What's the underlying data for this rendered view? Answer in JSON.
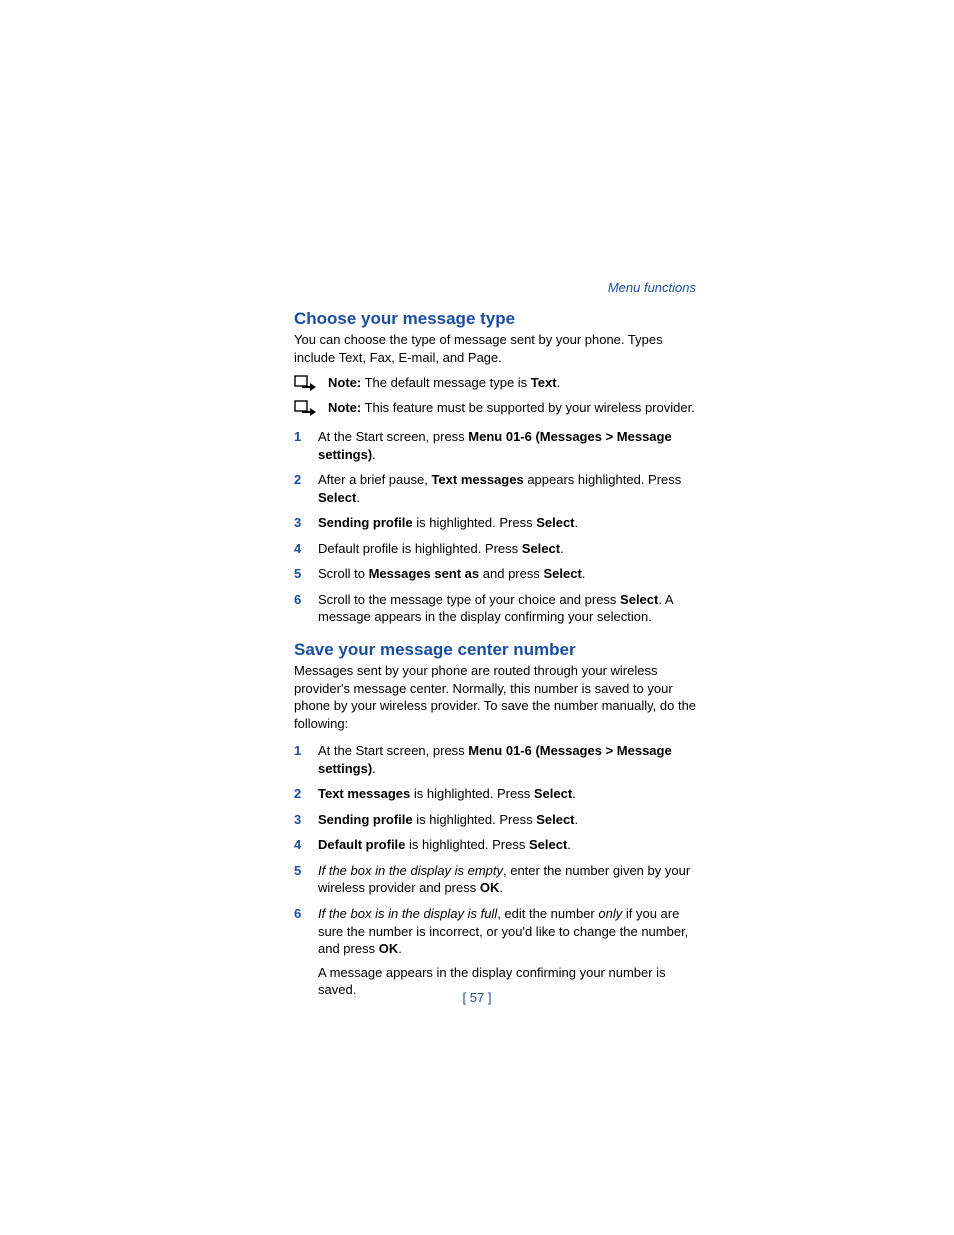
{
  "header": "Menu functions",
  "section1": {
    "title": "Choose your message type",
    "intro": "You can choose the type of message sent by your phone. Types include Text, Fax, E-mail, and Page.",
    "note1_label": "Note:",
    "note1_text": " The default message type is ",
    "note1_bold": "Text",
    "note1_after": ".",
    "note2_label": "Note:",
    "note2_text": " This feature must be supported by your wireless provider.",
    "steps": [
      {
        "n": "1",
        "pre": "At the Start screen, press ",
        "b1": "Menu 01-6 (Messages > Message settings)",
        "post": "."
      },
      {
        "n": "2",
        "pre": "After a brief pause, ",
        "b1": "Text messages",
        "mid": " appears highlighted. Press ",
        "b2": "Select",
        "post": "."
      },
      {
        "n": "3",
        "b1": "Sending profile",
        "mid": " is highlighted. Press ",
        "b2": "Select",
        "post": "."
      },
      {
        "n": "4",
        "pre": "Default profile is highlighted. Press ",
        "b1": "Select",
        "post": "."
      },
      {
        "n": "5",
        "pre": "Scroll to ",
        "b1": "Messages sent as",
        "mid": " and press ",
        "b2": "Select",
        "post": "."
      },
      {
        "n": "6",
        "pre": "Scroll to the message type of your choice and press ",
        "b1": "Select",
        "post": ". A message appears in the display confirming your selection."
      }
    ]
  },
  "section2": {
    "title": "Save your message center number",
    "intro": "Messages sent by your phone are routed through your wireless provider's message center. Normally, this number is saved to your phone by your wireless provider. To save the number manually, do the following:",
    "steps": [
      {
        "n": "1",
        "pre": "At the Start screen, press ",
        "b1": "Menu 01-6 (Messages > Message settings)",
        "post": "."
      },
      {
        "n": "2",
        "b1": "Text messages",
        "mid": " is highlighted. Press ",
        "b2": "Select",
        "post": "."
      },
      {
        "n": "3",
        "b1": "Sending profile",
        "mid": " is highlighted. Press ",
        "b2": "Select",
        "post": "."
      },
      {
        "n": "4",
        "b1": "Default profile",
        "mid": " is highlighted. Press ",
        "b2": "Select",
        "post": "."
      },
      {
        "n": "5",
        "i1": "If the box in the display is empty",
        "mid": ", enter the number given by your wireless provider and press ",
        "b2": "OK",
        "post": "."
      },
      {
        "n": "6",
        "i1": "If the box is in the display is full",
        "mid": ", edit the number ",
        "i2": "only",
        "mid2": " if you are sure the number is incorrect, or you'd like to change the number, and press ",
        "b2": "OK",
        "post": ".",
        "cont": "A message appears in the display confirming your number is saved."
      }
    ]
  },
  "page_number": "[ 57 ]"
}
